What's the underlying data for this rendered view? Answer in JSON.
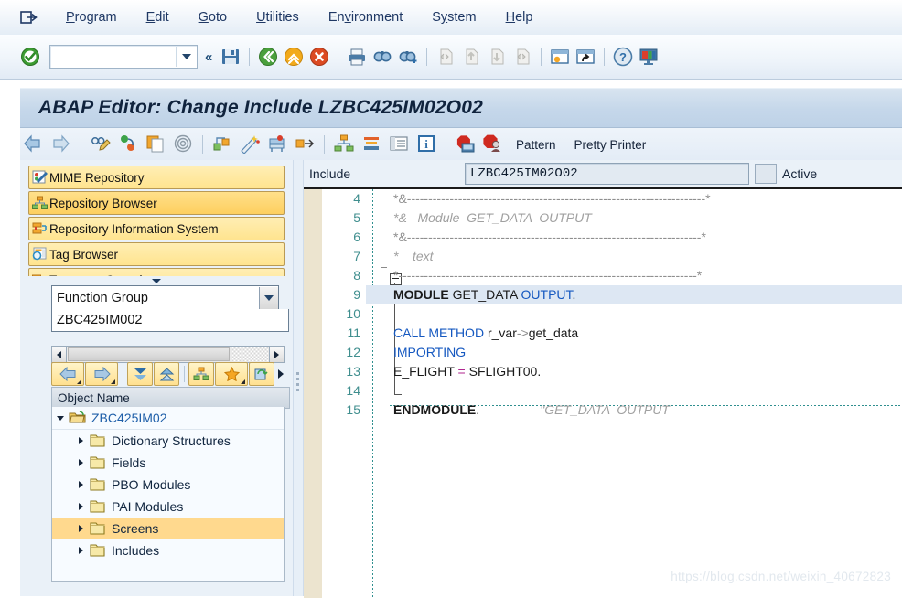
{
  "menubar": {
    "exit_icon": "exit-icon",
    "items": [
      {
        "label": "Program",
        "accel": "P"
      },
      {
        "label": "Edit",
        "accel": "E"
      },
      {
        "label": "Goto",
        "accel": "G"
      },
      {
        "label": "Utilities",
        "accel": "U"
      },
      {
        "label": "Environment",
        "accel": "v"
      },
      {
        "label": "System",
        "accel": "y"
      },
      {
        "label": "Help",
        "accel": "H"
      }
    ]
  },
  "toolbar": {
    "enter_icon": "green-check-enter-icon",
    "command_field_value": "",
    "command_field_placeholder": "",
    "dropdown_icon": "chevron-down-icon",
    "more_icon": "double-chevron-left-icon",
    "icons": [
      "save-icon",
      "back-green-icon",
      "exit-yellow-icon",
      "cancel-red-icon",
      "print-icon",
      "find-icon",
      "find-next-icon",
      "first-page-icon",
      "previous-page-icon",
      "next-page-icon",
      "last-page-icon",
      "create-session-icon",
      "create-shortcut-icon",
      "help-icon",
      "customize-layout-icon"
    ]
  },
  "window": {
    "title": "ABAP Editor: Change Include LZBC425IM02O02"
  },
  "app_toolbar": {
    "icons": [
      "back-arrow-icon",
      "forward-arrow-icon",
      "display-change-icon",
      "activate-icon",
      "copy-icon",
      "object-list-icon",
      "check-syntax-icon",
      "wand-icon",
      "debug-icon",
      "navigate-icon",
      "object-navigator-icon",
      "stack-icon",
      "list-icon",
      "info-icon",
      "breakpoint-icon",
      "stop-icon"
    ],
    "pattern_label": "Pattern",
    "pretty_printer_label": "Pretty Printer"
  },
  "sidebar": {
    "nav_items": [
      {
        "label": "MIME Repository",
        "icon": "mime-repository-icon",
        "selected": false
      },
      {
        "label": "Repository Browser",
        "icon": "repository-browser-icon",
        "selected": true
      },
      {
        "label": "Repository Information System",
        "icon": "repository-info-system-icon",
        "selected": false
      },
      {
        "label": "Tag Browser",
        "icon": "tag-browser-icon",
        "selected": false
      },
      {
        "label": "Transport Organizer",
        "icon": "transport-organizer-icon",
        "selected": false
      }
    ],
    "expand_icon": "chevron-down-icon",
    "object_type": {
      "value": "Function Group",
      "dropdown_icon": "chevron-down-icon"
    },
    "object_name_value": "ZBC425IM002",
    "scroll": {
      "left_icon": "scroll-left-icon",
      "right_icon": "scroll-right-icon"
    },
    "tree_toolbar_icons": [
      "back-icon",
      "forward-icon",
      "collapse-all-icon",
      "expand-all-icon",
      "object-list-icon",
      "favorites-icon",
      "refresh-icon",
      "overflow-icon"
    ],
    "tree_header": "Object Name",
    "tree": [
      {
        "label": "ZBC425IM02",
        "icon": "function-group-icon",
        "level": 0,
        "expanded": true,
        "selected": false
      },
      {
        "label": "Dictionary Structures",
        "icon": "folder-icon",
        "level": 1,
        "expanded": false,
        "selected": false
      },
      {
        "label": "Fields",
        "icon": "folder-icon",
        "level": 1,
        "expanded": false,
        "selected": false
      },
      {
        "label": "PBO Modules",
        "icon": "folder-icon",
        "level": 1,
        "expanded": false,
        "selected": false
      },
      {
        "label": "PAI Modules",
        "icon": "folder-icon",
        "level": 1,
        "expanded": false,
        "selected": false
      },
      {
        "label": "Screens",
        "icon": "folder-icon",
        "level": 1,
        "expanded": false,
        "selected": true
      },
      {
        "label": "Includes",
        "icon": "folder-icon",
        "level": 1,
        "expanded": false,
        "selected": false
      }
    ]
  },
  "editor": {
    "include_label": "Include",
    "include_value": "LZBC425IM02O02",
    "status_label": "Active",
    "first_line_number": 4,
    "lines": [
      {
        "n": 4,
        "segments": [
          {
            "t": "*&----------------------------------------------------------------------*",
            "c": "cm-plain"
          }
        ]
      },
      {
        "n": 5,
        "segments": [
          {
            "t": "*&   Module  GET_DATA  OUTPUT",
            "c": "cm"
          }
        ]
      },
      {
        "n": 6,
        "segments": [
          {
            "t": "*&---------------------------------------------------------------------*",
            "c": "cm-plain"
          }
        ]
      },
      {
        "n": 7,
        "segments": [
          {
            "t": "*    text",
            "c": "cm"
          }
        ]
      },
      {
        "n": 8,
        "segments": [
          {
            "t": "*----------------------------------------------------------------------*",
            "c": "cm-plain"
          }
        ]
      },
      {
        "n": 9,
        "highlight": true,
        "segments": [
          {
            "t": "MODULE ",
            "c": "kw"
          },
          {
            "t": "GET_DATA ",
            "c": "pl"
          },
          {
            "t": "OUTPUT",
            "c": "bl"
          },
          {
            "t": ".",
            "c": "pl"
          }
        ]
      },
      {
        "n": 10,
        "segments": [
          {
            "t": "",
            "c": "pl"
          }
        ]
      },
      {
        "n": 11,
        "segments": [
          {
            "t": "CALL METHOD ",
            "c": "bl"
          },
          {
            "t": "r_var",
            "c": "pl"
          },
          {
            "t": "->",
            "c": "cm-plain"
          },
          {
            "t": "get_data",
            "c": "pl"
          }
        ]
      },
      {
        "n": 12,
        "segments": [
          {
            "t": "IMPORTING",
            "c": "bl"
          }
        ]
      },
      {
        "n": 13,
        "segments": [
          {
            "t": "E_FLIGHT ",
            "c": "pl"
          },
          {
            "t": "=",
            "c": "mg"
          },
          {
            "t": " SFLIGHT00.",
            "c": "pl"
          }
        ]
      },
      {
        "n": 14,
        "segments": [
          {
            "t": "",
            "c": "pl"
          }
        ]
      },
      {
        "n": 15,
        "segments": [
          {
            "t": "ENDMODULE",
            "c": "kw"
          },
          {
            "t": ".",
            "c": "pl"
          },
          {
            "t": "                 \"GET_DATA  OUTPUT",
            "c": "cm"
          }
        ]
      }
    ]
  },
  "watermark": "https://blog.csdn.net/weixin_40672823",
  "colors": {
    "menu_text": "#1f3864",
    "nav_button": "#ffe48f",
    "nav_selected": "#fdcf5f",
    "tree_selected": "#ffd98e",
    "line_number": "#3f8e8e",
    "keyword_blue": "#1558c0",
    "comment_gray": "#a0a0a0",
    "operator_magenta": "#b0268f",
    "code_highlight": "#dde7f3",
    "title_bar": "#c5d7ea"
  }
}
